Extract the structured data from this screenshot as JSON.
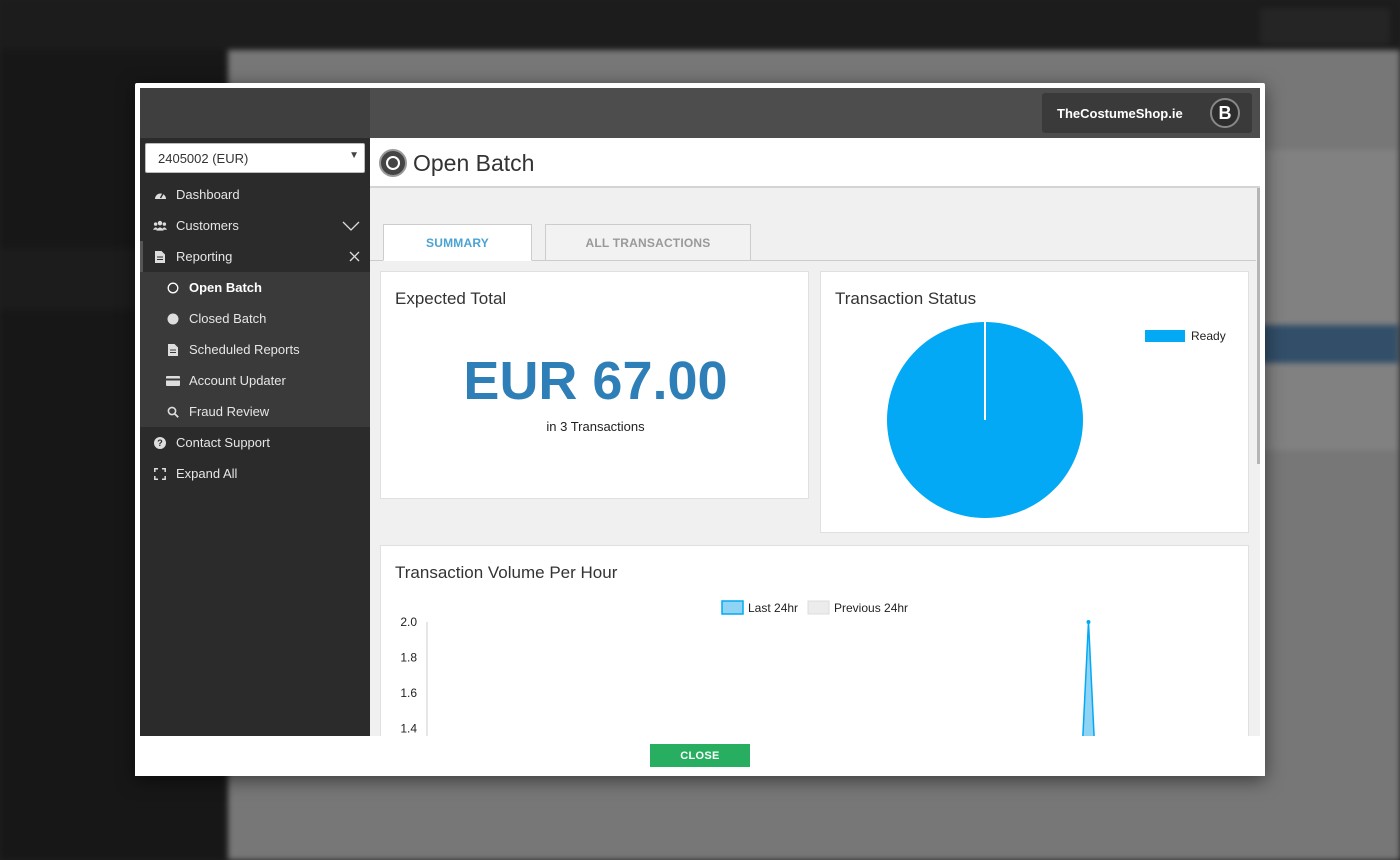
{
  "header": {
    "merchant_name": "TheCostumeShop.ie",
    "avatar_letter": "B"
  },
  "sidebar": {
    "batch_select_value": "2405002 (EUR)",
    "items": [
      {
        "label": "Dashboard",
        "icon": "dashboard-icon"
      },
      {
        "label": "Customers",
        "icon": "users-icon"
      },
      {
        "label": "Reporting",
        "icon": "document-icon"
      },
      {
        "label": "Contact Support",
        "icon": "question-circle-icon"
      },
      {
        "label": "Expand All",
        "icon": "expand-icon"
      }
    ],
    "reporting_subitems": [
      {
        "label": "Open Batch",
        "icon": "circle-outline-icon"
      },
      {
        "label": "Closed Batch",
        "icon": "circle-filled-icon"
      },
      {
        "label": "Scheduled Reports",
        "icon": "document-icon"
      },
      {
        "label": "Account Updater",
        "icon": "card-icon"
      },
      {
        "label": "Fraud Review",
        "icon": "search-icon"
      }
    ]
  },
  "page": {
    "title": "Open Batch",
    "tabs": [
      "SUMMARY",
      "ALL TRANSACTIONS"
    ],
    "active_tab": "SUMMARY"
  },
  "expected_total": {
    "title": "Expected Total",
    "amount": "EUR 67.00",
    "subtitle": "in 3 Transactions"
  },
  "transaction_status": {
    "title": "Transaction Status",
    "legend_label": "Ready"
  },
  "volume": {
    "title": "Transaction Volume Per Hour",
    "legend": [
      "Last 24hr",
      "Previous 24hr"
    ]
  },
  "footer": {
    "close_label": "CLOSE"
  },
  "colors": {
    "accent_blue": "#2e7fb7",
    "tab_active": "#4aa3d4",
    "pie_ready": "#03a9f4",
    "close_green": "#27ae60"
  },
  "chart_data": [
    {
      "type": "pie",
      "title": "Transaction Status",
      "categories": [
        "Ready"
      ],
      "values": [
        3
      ],
      "colors": [
        "#03a9f4"
      ],
      "legend_position": "top-right"
    },
    {
      "type": "area",
      "title": "Transaction Volume Per Hour",
      "yticks": [
        1.4,
        1.6,
        1.8,
        2.0
      ],
      "ylim": [
        1.4,
        2.0
      ],
      "series": [
        {
          "name": "Last 24hr",
          "peak_value": 2.0,
          "peak_position": 0.76,
          "color": "#03a9f4"
        },
        {
          "name": "Previous 24hr",
          "values": [],
          "color": "#e8e8e8"
        }
      ],
      "legend_position": "top-center"
    }
  ]
}
